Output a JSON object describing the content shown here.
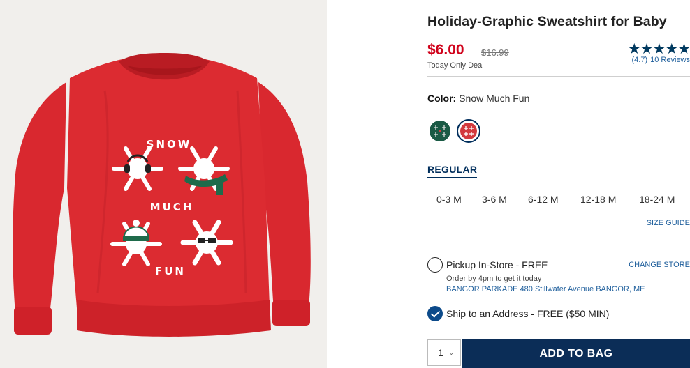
{
  "product": {
    "title": "Holiday-Graphic Sweatshirt for Baby",
    "image_alt": "Red holiday sweatshirt with snowflake characters",
    "graphic_text": [
      "SNOW",
      "MUCH",
      "FUN"
    ]
  },
  "pricing": {
    "price": "$6.00",
    "original_price": "$16.99",
    "deal_label": "Today Only Deal",
    "sale_color": "#d0021b"
  },
  "rating": {
    "stars_display": "★★★★★",
    "value": 4.7,
    "rating_text": "(4.7)",
    "reviews_text": "10 Reviews"
  },
  "color": {
    "label": "Color:",
    "selected": "Snow Much Fun",
    "swatches": [
      {
        "name": "green-holiday-swatch",
        "color": "#1a5a45"
      },
      {
        "name": "red-snow-much-fun-swatch",
        "color": "#d23a3f",
        "selected": true
      }
    ]
  },
  "fit": {
    "selected_tab": "REGULAR"
  },
  "sizes": [
    "0-3 M",
    "3-6 M",
    "6-12 M",
    "12-18 M",
    "18-24 M"
  ],
  "size_guide": "SIZE GUIDE",
  "fulfillment": {
    "pickup_label": "Pickup In-Store - FREE",
    "change_store": "CHANGE STORE",
    "order_by": "Order by 4pm to get it today",
    "store_address": "BANGOR PARKADE 480 Stillwater Avenue  BANGOR, ME",
    "ship_label": "Ship to an Address - FREE ($50 MIN)",
    "ship_selected": true
  },
  "cart": {
    "quantity": "1",
    "add_label": "ADD TO BAG",
    "brand_color": "#0b2d57"
  }
}
